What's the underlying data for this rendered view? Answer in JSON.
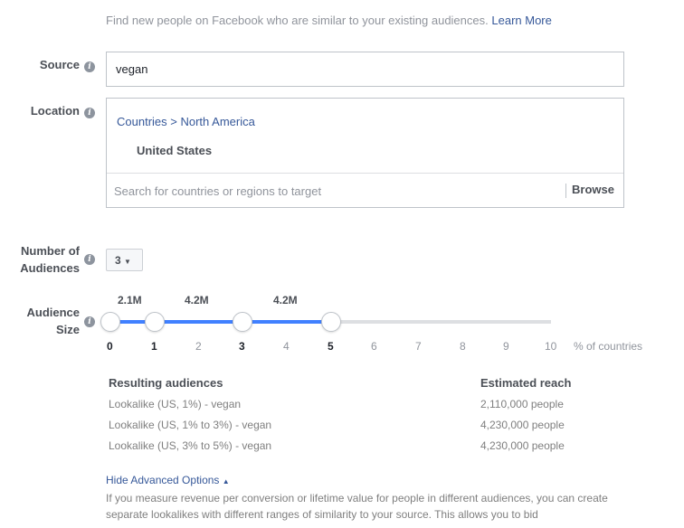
{
  "intro": {
    "text": "Find new people on Facebook who are similar to your existing audiences.",
    "learn_more": "Learn More"
  },
  "source": {
    "label": "Source",
    "value": "vegan"
  },
  "location": {
    "label": "Location",
    "breadcrumb": [
      "Countries",
      ">",
      "North America"
    ],
    "selected": "United States",
    "search_placeholder": "Search for countries or regions to target",
    "browse_label": "Browse"
  },
  "number_of_audiences": {
    "label_line1": "Number of",
    "label_line2": "Audiences",
    "value": "3"
  },
  "audience_size": {
    "label_line1": "Audience",
    "label_line2": "Size",
    "handle_values": [
      0,
      1,
      3,
      5
    ],
    "segment_labels": [
      "2.1M",
      "4.2M",
      "4.2M"
    ],
    "ticks": [
      "0",
      "1",
      "2",
      "3",
      "4",
      "5",
      "6",
      "7",
      "8",
      "9",
      "10"
    ],
    "unit": "% of countries",
    "accent_color": "#4080ff"
  },
  "results": {
    "header_audiences": "Resulting audiences",
    "header_reach": "Estimated reach",
    "rows": [
      {
        "name": "Lookalike (US, 1%) - vegan",
        "reach": "2,110,000 people"
      },
      {
        "name": "Lookalike (US, 1% to 3%) - vegan",
        "reach": "4,230,000 people"
      },
      {
        "name": "Lookalike (US, 3% to 5%) - vegan",
        "reach": "4,230,000 people"
      }
    ]
  },
  "advanced": {
    "toggle_label": "Hide Advanced Options",
    "description": "If you measure revenue per conversion or lifetime value for people in different audiences, you can create separate lookalikes with different ranges of similarity to your source. This allows you to bid"
  }
}
